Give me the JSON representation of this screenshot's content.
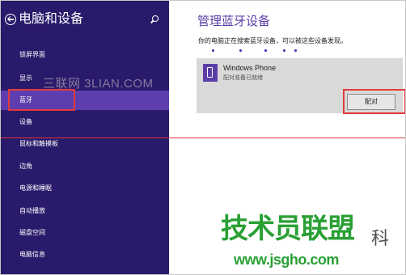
{
  "sidebar": {
    "title": "电脑和设备",
    "items": [
      {
        "label": "锁屏界面"
      },
      {
        "label": "显示"
      },
      {
        "label": "蓝牙",
        "selected": true
      },
      {
        "label": "设备"
      },
      {
        "label": "鼠标和触摸板"
      },
      {
        "label": "边角"
      },
      {
        "label": "电源和睡眠"
      },
      {
        "label": "自动播放"
      },
      {
        "label": "磁盘空间"
      },
      {
        "label": "电脑信息"
      }
    ]
  },
  "main": {
    "title": "管理蓝牙设备",
    "description": "你的电脑正在搜索蓝牙设备，可以被这些设备发现。",
    "device": {
      "name": "Windows Phone",
      "status": "配对准备已就绪",
      "icon": "phone-icon",
      "pair_button": "配对"
    }
  },
  "watermarks": {
    "top": "三联网 3LIAN.COM",
    "bottom_logo": "技术员联盟",
    "bottom_trailing": "科",
    "bottom_url": "www.jsgho.com"
  },
  "colors": {
    "sidebar_bg": "#2a1a6b",
    "sidebar_selected": "#5e3eaf",
    "accent": "#5b3ea8",
    "highlight_border": "#e23a3a",
    "device_card_bg": "#d9d9d9"
  }
}
